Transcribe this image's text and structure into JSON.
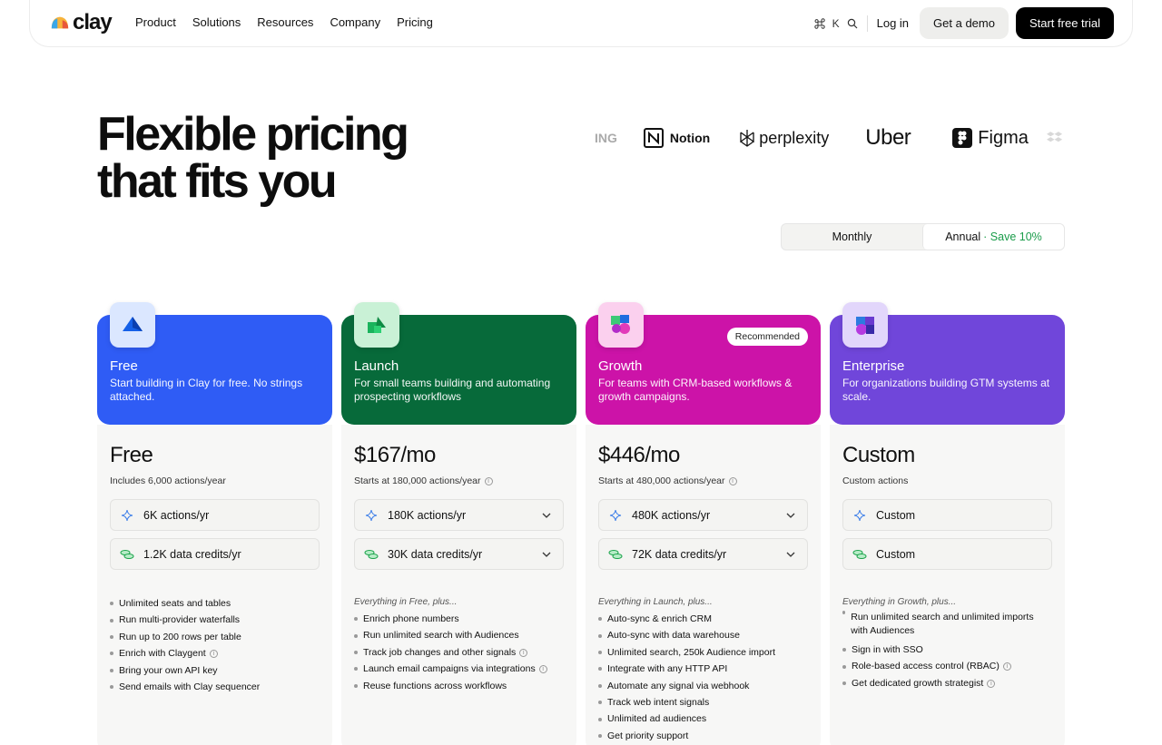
{
  "nav": {
    "brand": "clay",
    "links": [
      "Product",
      "Solutions",
      "Resources",
      "Company",
      "Pricing"
    ],
    "shortcut_key": "K",
    "login": "Log in",
    "demo": "Get a demo",
    "trial": "Start free trial"
  },
  "hero": {
    "title_line1": "Flexible pricing",
    "title_line2": "that fits you"
  },
  "logos": [
    "ING",
    "Notion",
    "perplexity",
    "Uber",
    "Figma"
  ],
  "billing": {
    "monthly": "Monthly",
    "annual": "Annual",
    "save": "· Save 10%"
  },
  "plans": [
    {
      "name": "Free",
      "desc": "Start building in Clay for free. No strings attached.",
      "color": "#2f5cf5",
      "price": "Free",
      "sub": "Includes 6,000 actions/year",
      "actions": "6K actions/yr",
      "credits": "1.2K data credits/yr",
      "intro": "",
      "features": [
        "Unlimited seats and tables",
        "Run multi-provider waterfalls",
        "Run up to 200 rows per table",
        "Enrich with Claygent",
        "Bring your own API key",
        "Send emails with Clay sequencer"
      ]
    },
    {
      "name": "Launch",
      "desc": "For small teams building and automating prospecting workflows",
      "color": "#076a3a",
      "price": "$167/mo",
      "sub": "Starts at 180,000 actions/year",
      "actions": "180K actions/yr",
      "credits": "30K data credits/yr",
      "intro": "Everything in Free, plus...",
      "features": [
        "Enrich phone numbers",
        "Run unlimited search with Audiences",
        "Track job changes and other signals",
        "Launch email campaigns via integrations",
        "Reuse functions across workflows"
      ]
    },
    {
      "name": "Growth",
      "desc": "For teams with CRM-based workflows & growth campaigns.",
      "color": "#cc13a8",
      "badge": "Recommended",
      "price": "$446/mo",
      "sub": "Starts at 480,000 actions/year",
      "actions": "480K actions/yr",
      "credits": "72K data credits/yr",
      "intro": "Everything in Launch, plus...",
      "features": [
        "Auto-sync & enrich CRM",
        "Auto-sync with data warehouse",
        "Unlimited search, 250k Audience import",
        "Integrate with any HTTP API",
        "Automate any signal via webhook",
        "Track web intent signals",
        "Unlimited ad audiences",
        "Get priority support"
      ]
    },
    {
      "name": "Enterprise",
      "desc": "For organizations building GTM systems at scale.",
      "color": "#7046da",
      "price": "Custom",
      "sub": "Custom actions",
      "actions": "Custom",
      "credits": "Custom",
      "intro": "Everything in Growth, plus...",
      "features": [
        "Run unlimited search and unlimited imports with Audiences",
        "Sign in with SSO",
        "Role-based access control (RBAC)",
        "Get dedicated growth strategist"
      ]
    }
  ]
}
